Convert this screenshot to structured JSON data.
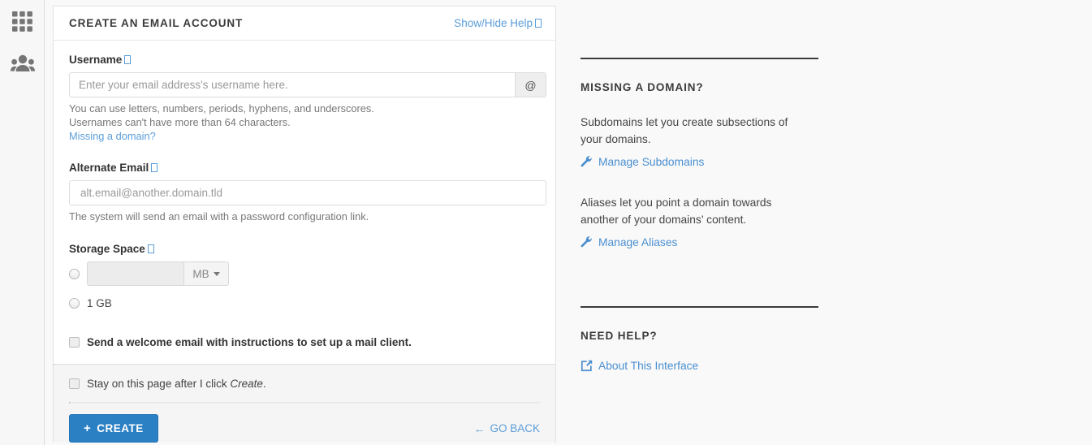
{
  "sidebar": {
    "items": [
      {
        "name": "apps-grid-icon",
        "label": "Apps"
      },
      {
        "name": "users-group-icon",
        "label": "Users"
      }
    ]
  },
  "card": {
    "title": "CREATE AN EMAIL ACCOUNT",
    "help_toggle": "Show/Hide Help",
    "username": {
      "label": "Username",
      "placeholder": "Enter your email address's username here.",
      "value": "",
      "addon": "@",
      "hints": [
        "You can use letters, numbers, periods, hyphens, and underscores.",
        "Usernames can't have more than 64 characters."
      ],
      "link": "Missing a domain?"
    },
    "alternate_email": {
      "label": "Alternate Email",
      "placeholder": "alt.email@another.domain.tld",
      "value": "",
      "hint": "The system will send an email with a password configuration link."
    },
    "storage": {
      "label": "Storage Space",
      "custom": {
        "value": "",
        "unit": "MB",
        "selected": false
      },
      "preset": {
        "label": "1 GB",
        "selected": false
      }
    },
    "welcome_email": {
      "label": "Send a welcome email with instructions to set up a mail client.",
      "checked": false
    },
    "stay_on_page": {
      "prefix": "Stay on this page after I click ",
      "emphasis": "Create",
      "suffix": ".",
      "checked": false
    },
    "actions": {
      "create": "CREATE",
      "create_icon": "plus-icon",
      "go_back": "GO BACK",
      "go_back_icon": "arrow-left-icon"
    }
  },
  "help_panel": {
    "sections": [
      {
        "heading": "MISSING A DOMAIN?",
        "blocks": [
          {
            "paragraph": "Subdomains let you create subsections of your domains.",
            "link": "Manage Subdomains",
            "link_icon": "wrench-icon"
          },
          {
            "paragraph": "Aliases let you point a domain towards another of your domains’ content.",
            "link": "Manage Aliases",
            "link_icon": "wrench-icon"
          }
        ]
      },
      {
        "heading": "NEED HELP?",
        "blocks": [
          {
            "paragraph": "",
            "link": "About This Interface",
            "link_icon": "external-link-icon"
          }
        ]
      }
    ]
  },
  "colors": {
    "accent_blue": "#2b80c4",
    "link_blue": "#5b9dd9",
    "page_bg": "#f9f9f9",
    "card_bg": "#ffffff",
    "footer_bg": "#f5f5f5"
  }
}
